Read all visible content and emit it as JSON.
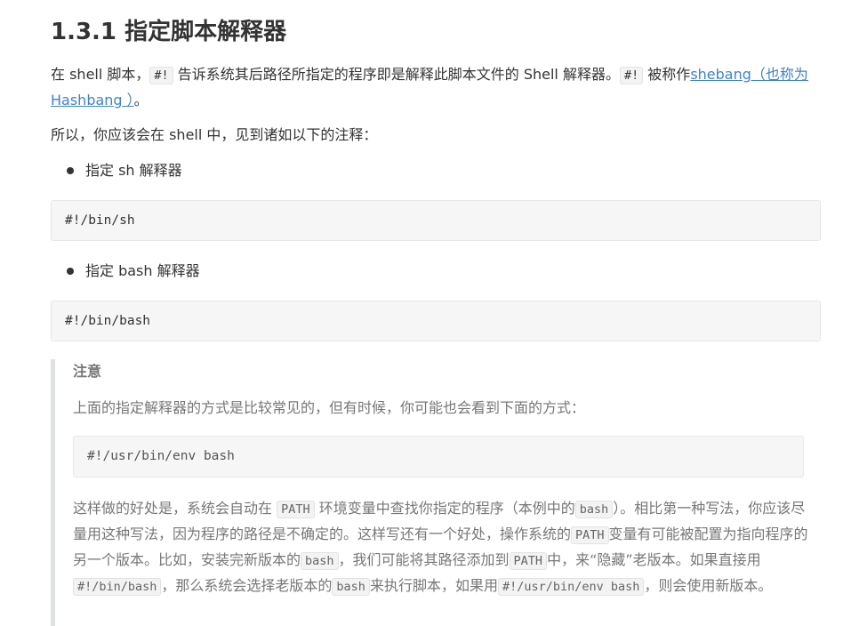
{
  "heading": "1.3.1 指定脚本解释器",
  "para1": {
    "t1": "在 shell 脚本，",
    "code1": "#!",
    "t2": " 告诉系统其后路径所指定的程序即是解释此脚本文件的 Shell 解释器。",
    "code2": "#!",
    "t3": " 被称作",
    "link": "shebang（也称为 Hashbang ）",
    "t4": "。"
  },
  "para2": "所以，你应该会在 shell 中，见到诸如以下的注释：",
  "bullet1": "指定 sh 解释器",
  "code_sh": "#!/bin/sh",
  "bullet2": "指定 bash 解释器",
  "code_bash": "#!/bin/bash",
  "note": {
    "title": "注意",
    "para1": "上面的指定解释器的方式是比较常见的，但有时候，你可能也会看到下面的方式：",
    "code": "#!/usr/bin/env bash",
    "para2": {
      "t1": "这样做的好处是，系统会自动在 ",
      "c1": "PATH",
      "t2": " 环境变量中查找你指定的程序（本例中的",
      "c2": "bash",
      "t3": "）。相比第一种写法，你应该尽量用这种写法，因为程序的路径是不确定的。这样写还有一个好处，操作系统的",
      "c3": "PATH",
      "t4": "变量有可能被配置为指向程序的另一个版本。比如，安装完新版本的",
      "c4": "bash",
      "t5": "，我们可能将其路径添加到",
      "c5": "PATH",
      "t6": "中，来“隐藏”老版本。如果直接用",
      "c6": "#!/bin/bash",
      "t7": "，那么系统会选择老版本的",
      "c7": "bash",
      "t8": "来执行脚本，如果用",
      "c8": "#!/usr/bin/env bash",
      "t9": "，则会使用新版本。"
    }
  }
}
